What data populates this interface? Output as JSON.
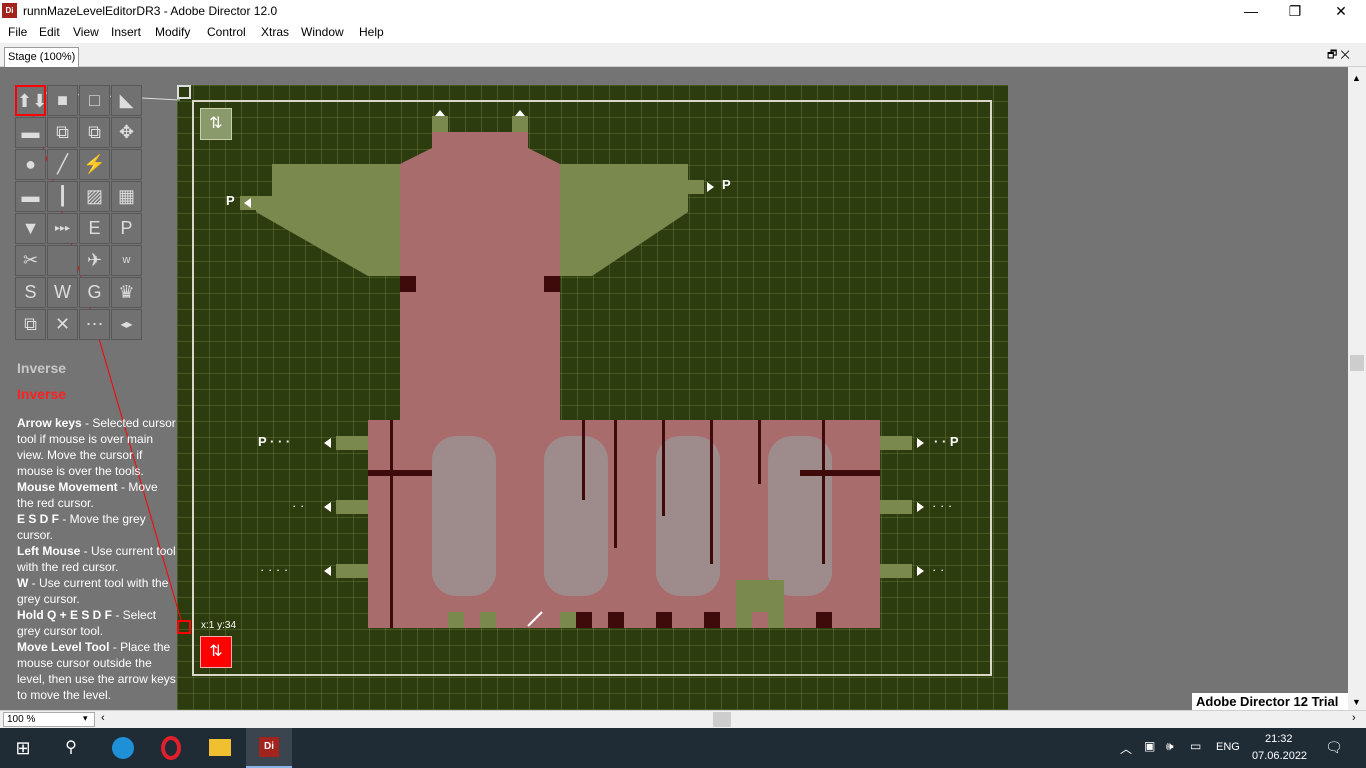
{
  "window": {
    "title": "runnMazeLevelEditorDR3 - Adobe Director 12.0",
    "app_icon_text": "Di",
    "minimize": "—",
    "maximize": "❐",
    "close": "✕"
  },
  "menu": [
    "File",
    "Edit",
    "View",
    "Insert",
    "Modify",
    "Control",
    "Xtras",
    "Window",
    "Help"
  ],
  "tab": {
    "label": "Stage (100%)",
    "controls": "🗗 ✕"
  },
  "toolbox": {
    "tools": [
      "⬆⬇",
      "■",
      "□",
      "◣",
      "▬",
      "⧉",
      "⧉",
      "✥",
      "●",
      "╱",
      "⚡",
      "",
      "▬",
      "┃",
      "▨",
      "▦",
      "▼",
      "▸▸▸",
      "E",
      "P",
      "✂",
      "",
      "✈",
      "w",
      "S",
      "W",
      "G",
      "♛",
      "⧉",
      "✕",
      "⋯",
      "◂▸"
    ]
  },
  "help": {
    "inverse_grey": "Inverse",
    "inverse_red": "Inverse",
    "lines": [
      {
        "key": "Arrow keys",
        "text": " - Selected cursor tool if mouse is over main view. Move the cursor if mouse is over the tools."
      },
      {
        "key": "Mouse Movement",
        "text": " - Move the red cursor."
      },
      {
        "key": "E S D F",
        "text": " - Move the grey cursor."
      },
      {
        "key": "Left Mouse",
        "text": " - Use current tool with the red cursor."
      },
      {
        "key": "W",
        "text": " - Use current tool with the grey cursor."
      },
      {
        "key": "Hold Q + E S D F",
        "text": " - Select grey cursor tool."
      },
      {
        "key": "Move Level Tool",
        "text": " - Place the mouse cursor outside the level, then use the arrow keys to move the level."
      }
    ]
  },
  "level": {
    "coords": "x:1 y:34",
    "p_labels": [
      "P",
      "P",
      "P",
      "P"
    ],
    "dots_left_1": "P · · ·",
    "dots_right_1": "· · P",
    "dots_2": "· ·",
    "dots_3": "· · · ·",
    "dots_4": "· · ·",
    "dots_5": "· ·"
  },
  "trial_label": "Adobe Director 12 Trial",
  "zoom": "100 %",
  "taskbar": {
    "lang": "ENG",
    "time": "21:32",
    "date": "07.06.2022"
  },
  "colors": {
    "board": "#2d3c0e",
    "pink": "#a86c6c",
    "olive": "#7a8a4e",
    "dark": "#3e0a0a",
    "stage_bg": "#747474",
    "accent_red": "#ff0000"
  }
}
